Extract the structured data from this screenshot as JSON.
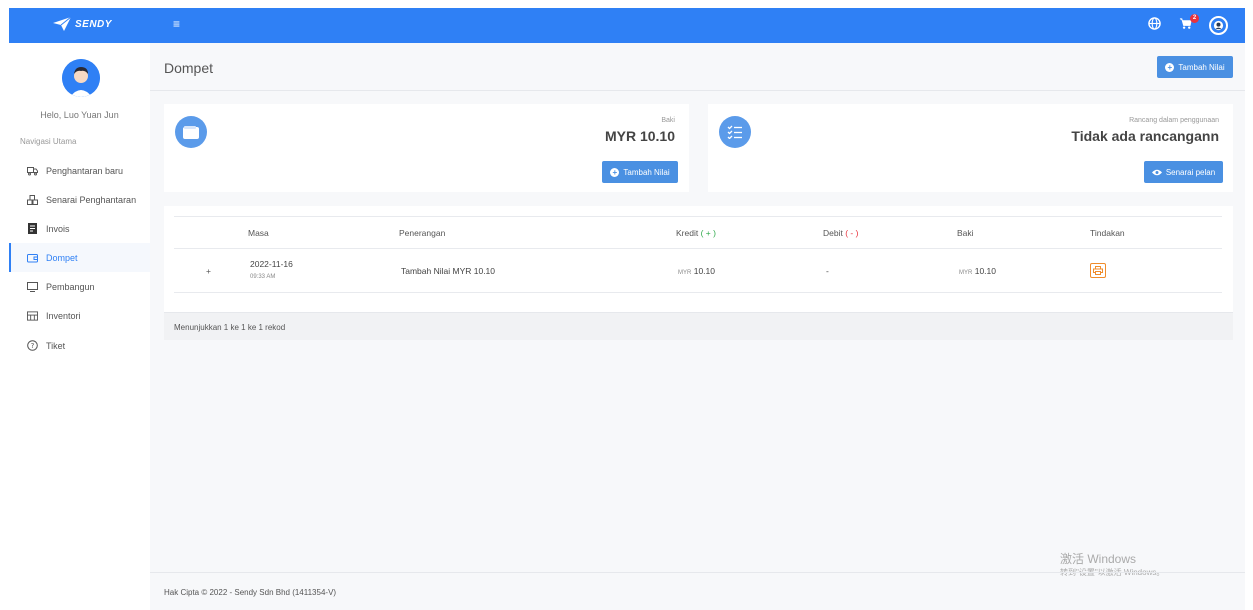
{
  "header": {
    "logo_text": "SENDY",
    "menu_icon": "hamburger-icon",
    "cart_count": "2"
  },
  "sidebar": {
    "greeting": "Helo, Luo Yuan Jun",
    "nav_title": "Navigasi Utama",
    "items": [
      {
        "label": "Penghantaran baru",
        "icon": "truck-icon"
      },
      {
        "label": "Senarai Penghantaran",
        "icon": "boxes-icon"
      },
      {
        "label": "Invois",
        "icon": "invoice-icon"
      },
      {
        "label": "Dompet",
        "icon": "wallet-icon",
        "active": true
      },
      {
        "label": "Pembangun",
        "icon": "code-icon"
      },
      {
        "label": "Inventori",
        "icon": "inventory-icon"
      },
      {
        "label": "Tiket",
        "icon": "ticket-icon"
      }
    ]
  },
  "page": {
    "title": "Dompet",
    "add_value_button": "Tambah Nilai"
  },
  "balance_card": {
    "label": "Baki",
    "value": "MYR 10.10",
    "button": "Tambah Nilai"
  },
  "plan_card": {
    "label": "Rancang dalam penggunaan",
    "value": "Tidak ada rancangann",
    "button": "Senarai pelan"
  },
  "table": {
    "columns": [
      "Masa",
      "Penerangan",
      "Kredit",
      "Debit",
      "Baki",
      "Tindakan"
    ],
    "credit_sign": "( + )",
    "debit_sign": "( - )",
    "rows": [
      {
        "expand": "+",
        "date": "2022-11-16",
        "time": "09:33 AM",
        "description": "Tambah Nilai MYR 10.10",
        "credit_currency": "MYR",
        "credit_value": "10.10",
        "debit": "-",
        "balance_currency": "MYR",
        "balance_value": "10.10"
      }
    ],
    "footer": "Menunjukkan 1 ke 1 ke 1 rekod"
  },
  "footer": {
    "copyright": "Hak Cipta © 2022 - Sendy Sdn Bhd (1411354-V)"
  },
  "watermark": {
    "line1": "激活 Windows",
    "line2": "转到\"设置\"以激活 Windows。"
  },
  "colors": {
    "primary": "#2f80f5",
    "button": "#4a90e2",
    "credit": "#2eaa4b",
    "debit": "#e8323c",
    "print": "#f08c2b"
  }
}
